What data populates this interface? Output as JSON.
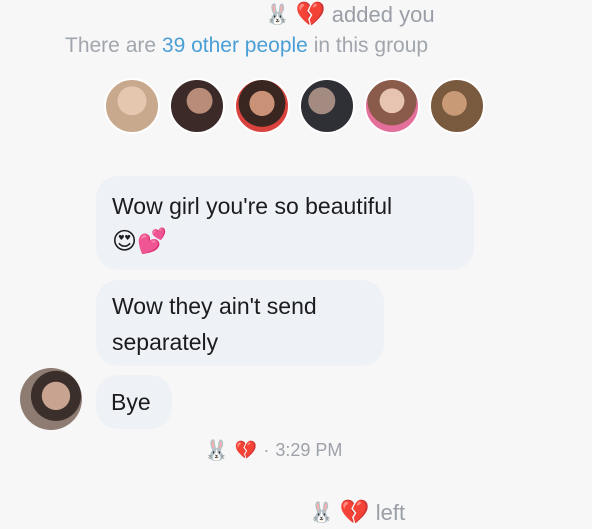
{
  "system": {
    "added_text": "added you",
    "group_prefix": "There are ",
    "group_link": "39 other people",
    "group_suffix": " in this group",
    "left_text": "left",
    "bunny_glyph": "🐰",
    "heart_glyph": "💔"
  },
  "members": [
    {
      "id": "m1",
      "color": "#c9a98e"
    },
    {
      "id": "m2",
      "color": "#3b2a28"
    },
    {
      "id": "m3",
      "color": "#b8543f"
    },
    {
      "id": "m4",
      "color": "#8e7f78"
    },
    {
      "id": "m5",
      "color": "#d9b2a3"
    },
    {
      "id": "m6",
      "color": "#7a5a3f"
    }
  ],
  "messages": [
    {
      "text": "Wow girl you're so beautiful",
      "emojis": "😍💕"
    },
    {
      "text": "Wow they ain't send separately"
    },
    {
      "text": "Bye"
    }
  ],
  "timestamp": "3:29 PM",
  "timestamp_sep": "·"
}
